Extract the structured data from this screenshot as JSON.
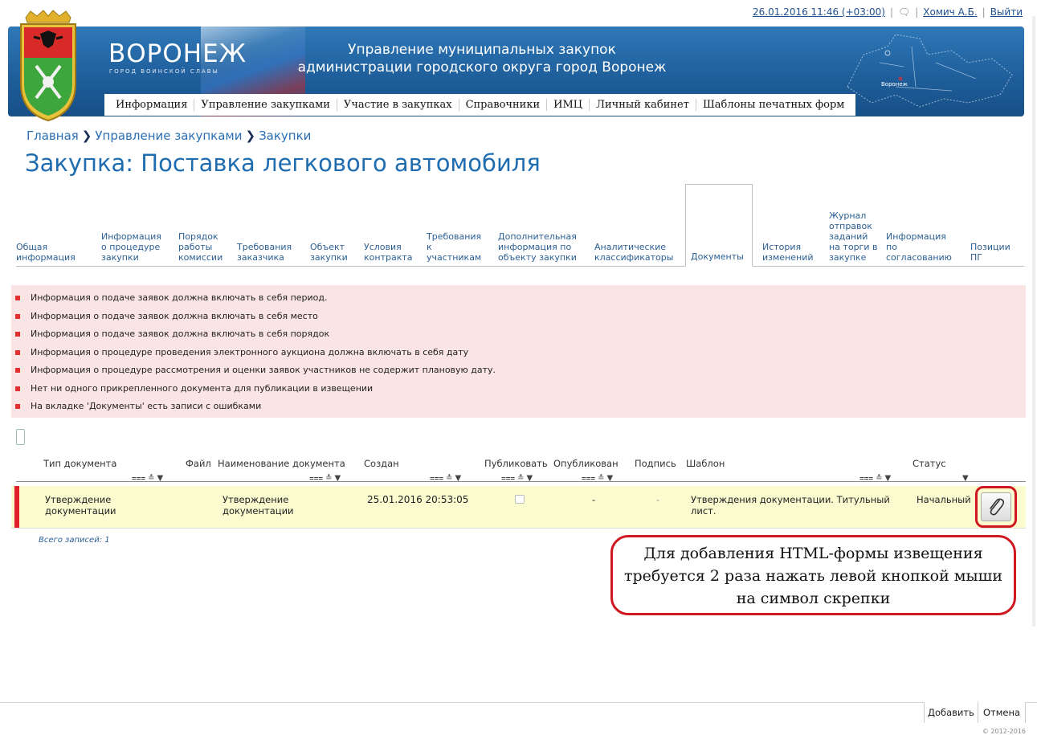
{
  "topbar": {
    "datetime": "26.01.2016 11:46 (+03:00)",
    "user": "Хомич А.Б.",
    "logout": "Выйти"
  },
  "header": {
    "city": "ВОРОНЕЖ",
    "slogan": "ГОРОД ВОИНСКОЙ СЛАВЫ",
    "org_line1": "Управление муниципальных закупок",
    "org_line2": "администрации городского округа город Воронеж",
    "map_label": "Воронеж"
  },
  "nav": [
    "Информация",
    "Управление закупками",
    "Участие в закупках",
    "Справочники",
    "ИМЦ",
    "Личный кабинет",
    "Шаблоны печатных форм"
  ],
  "breadcrumb": [
    "Главная",
    "Управление закупками",
    "Закупки"
  ],
  "page_title": "Закупка: Поставка легкового автомобиля",
  "tabs": [
    "Общая информация",
    "Информация о процедуре закупки",
    "Порядок работы комиссии",
    "Требования заказчика",
    "Объект закупки",
    "Условия контракта",
    "Требования к участникам",
    "Дополнительная информация по объекту закупки",
    "Аналитические классификаторы",
    "Документы",
    "История изменений",
    "Журнал отправок заданий на торги в закупке",
    "Информация по согласованию",
    "Позиции ПГ"
  ],
  "errors": [
    "Информация о подаче заявок должна включать в себя период.",
    "Информация о подаче заявок должна включать в себя место",
    "Информация о подаче заявок должна включать в себя порядок",
    "Информация о процедуре проведения электронного аукциона должна включать в себя дату",
    "Информация о процедуре рассмотрения и оценки заявок участников не содержит плановую дату.",
    "Нет ни одного прикрепленного документа для публикации в извещении",
    "На вкладке 'Документы' есть записи с ошибками"
  ],
  "grid": {
    "headers": {
      "doc_type": "Тип документа",
      "file": "Файл",
      "doc_name": "Наименование документа",
      "created": "Создан",
      "publish": "Публиковать",
      "published": "Опубликован",
      "signature": "Подпись",
      "template": "Шаблон",
      "status": "Статус"
    },
    "row": {
      "doc_type": "Утверждение документации",
      "doc_name": "Утверждение документации",
      "created": "25.01.2016 20:53:05",
      "published": "-",
      "signature": "-",
      "template": "Утверждения документации. Титульный лист.",
      "status": "Начальный"
    },
    "total": "Всего записей: 1"
  },
  "callout": "Для добавления HTML-формы извещения требуется 2 раза нажать левой кнопкой мыши на символ скрепки",
  "buttons": {
    "add": "Добавить",
    "cancel": "Отмена"
  },
  "copyright": "© 2012-2016"
}
